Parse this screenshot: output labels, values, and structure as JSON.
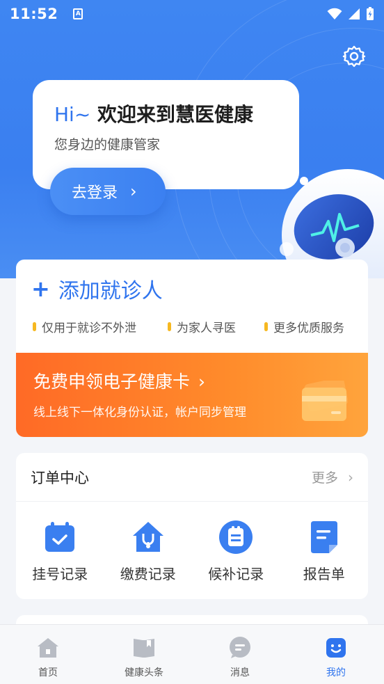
{
  "status_bar": {
    "time": "11:52",
    "badge": "A"
  },
  "welcome": {
    "hi": "Hi~",
    "title": "欢迎来到慧医健康",
    "subtitle": "您身边的健康管家",
    "login_label": "去登录"
  },
  "add_patient": {
    "label": "添加就诊人",
    "tags": [
      "仅用于就诊不外泄",
      "为家人寻医",
      "更多优质服务"
    ]
  },
  "health_card": {
    "title": "免费申领电子健康卡",
    "subtitle": "线上线下一体化身份认证，帐户同步管理"
  },
  "order_center": {
    "title": "订单中心",
    "more": "更多",
    "items": [
      {
        "label": "挂号记录",
        "icon": "calendar-check-icon"
      },
      {
        "label": "缴费记录",
        "icon": "house-stethoscope-icon"
      },
      {
        "label": "候补记录",
        "icon": "clipboard-icon"
      },
      {
        "label": "报告单",
        "icon": "document-icon"
      }
    ]
  },
  "tabbar": {
    "items": [
      {
        "label": "首页",
        "icon": "home-icon",
        "active": false
      },
      {
        "label": "健康头条",
        "icon": "book-icon",
        "active": false
      },
      {
        "label": "消息",
        "icon": "message-icon",
        "active": false
      },
      {
        "label": "我的",
        "icon": "profile-icon",
        "active": true
      }
    ]
  },
  "colors": {
    "primary": "#2f74ee",
    "hero_bg": "#3f86f2",
    "orange": "#ff7a29",
    "tag_dot": "#f6b821"
  }
}
